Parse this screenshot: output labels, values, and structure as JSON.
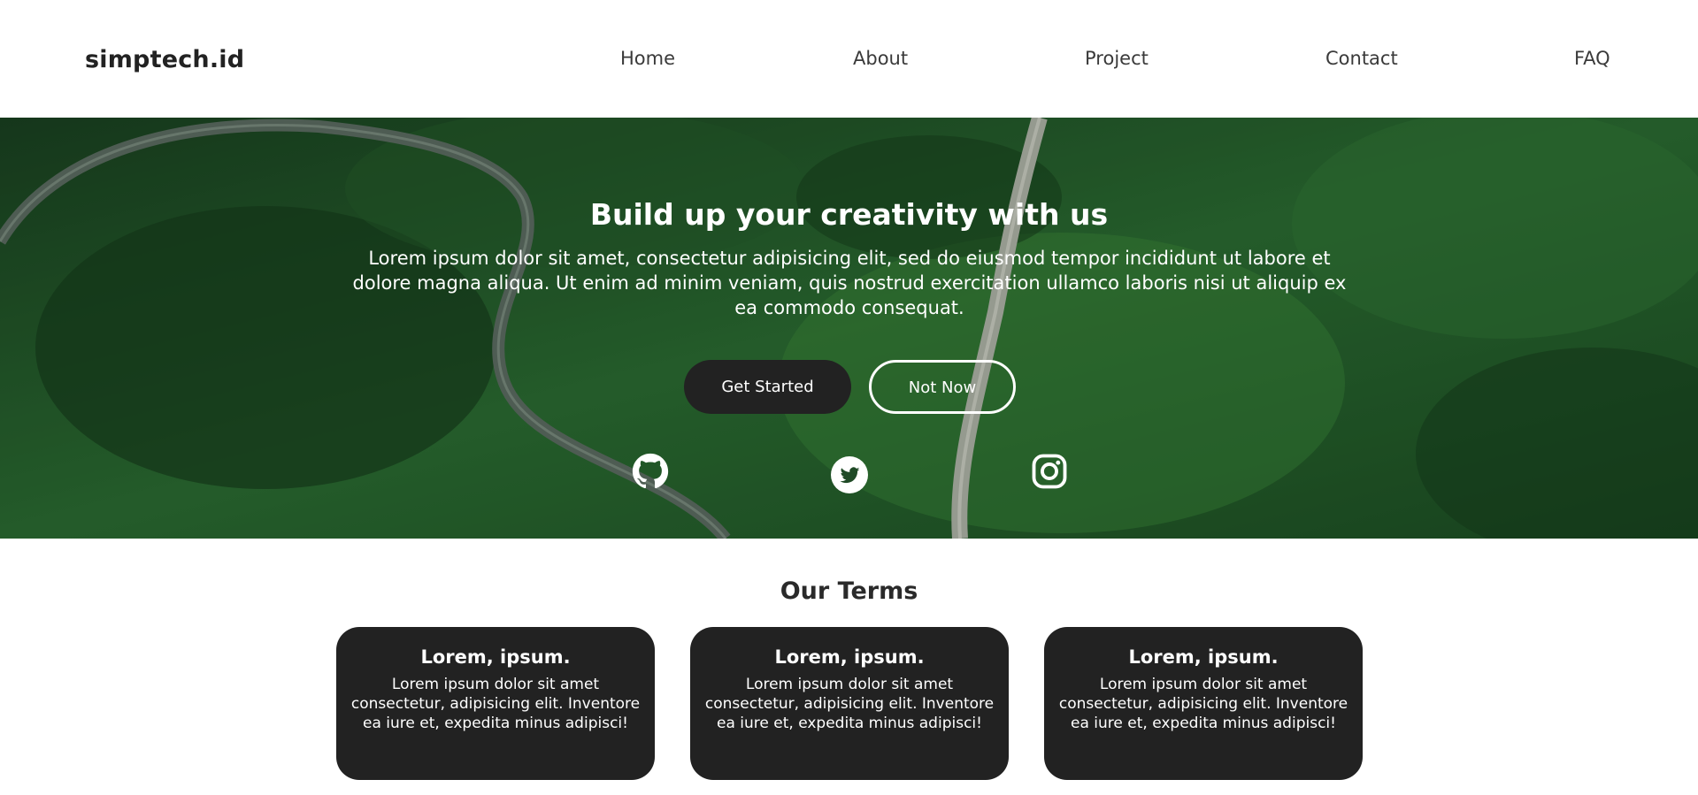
{
  "navbar": {
    "brand": "simptech.id",
    "links": [
      "Home",
      "About",
      "Project",
      "Contact",
      "FAQ"
    ]
  },
  "hero": {
    "title": "Build up your creativity with us",
    "text": "Lorem ipsum dolor sit amet, consectetur adipisicing elit, sed do eiusmod tempor incididunt ut labore et dolore magna aliqua. Ut enim ad minim veniam, quis nostrud exercitation ullamco laboris nisi ut aliquip ex ea commodo consequat.",
    "primary_button": "Get Started",
    "secondary_button": "Not Now",
    "social_icons": [
      "github-icon",
      "twitter-icon",
      "instagram-icon"
    ]
  },
  "terms": {
    "title": "Our Terms",
    "cards": [
      {
        "title": "Lorem, ipsum.",
        "text": "Lorem ipsum dolor sit amet consectetur, adipisicing elit. Inventore ea iure et, expedita minus adipisci!"
      },
      {
        "title": "Lorem, ipsum.",
        "text": "Lorem ipsum dolor sit amet consectetur, adipisicing elit. Inventore ea iure et, expedita minus adipisci!"
      },
      {
        "title": "Lorem, ipsum.",
        "text": "Lorem ipsum dolor sit amet consectetur, adipisicing elit. Inventore ea iure et, expedita minus adipisci!"
      }
    ]
  },
  "colors": {
    "dark": "#222222",
    "white": "#ffffff",
    "forest": "#1f4a26"
  }
}
